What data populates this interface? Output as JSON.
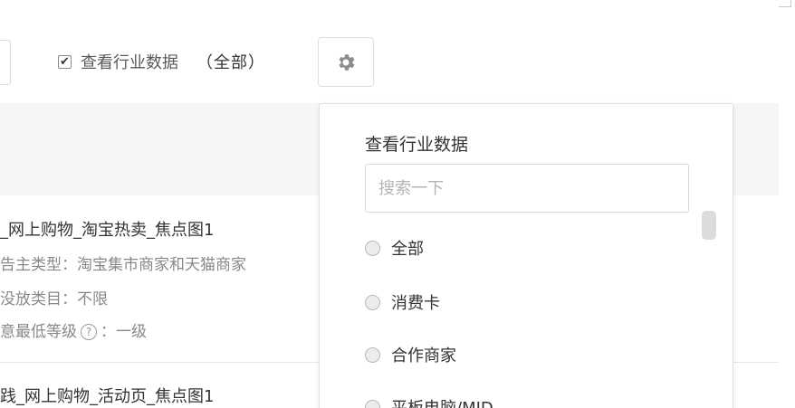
{
  "filter": {
    "checked": true,
    "label": "查看行业数据",
    "scope": "（全部）"
  },
  "gear_icon": "gear-icon",
  "list": [
    {
      "title": "_网上购物_淘宝热卖_焦点图1",
      "meta": [
        {
          "label": "告主类型：",
          "value": "淘宝集市商家和天猫商家"
        },
        {
          "label": "没放类目：",
          "value": "不限"
        },
        {
          "label": "意最低等级",
          "value": "：一级",
          "has_help": true
        }
      ]
    },
    {
      "title": "践_网上购物_活动页_焦点图1"
    }
  ],
  "dropdown": {
    "title": "查看行业数据",
    "search_placeholder": "搜索一下",
    "options": [
      "全部",
      "消费卡",
      "合作商家",
      "平板电脑/MID"
    ]
  },
  "colors": {
    "border": "#dedede",
    "header_bg": "#f6f6f6",
    "muted_text": "#888888"
  }
}
